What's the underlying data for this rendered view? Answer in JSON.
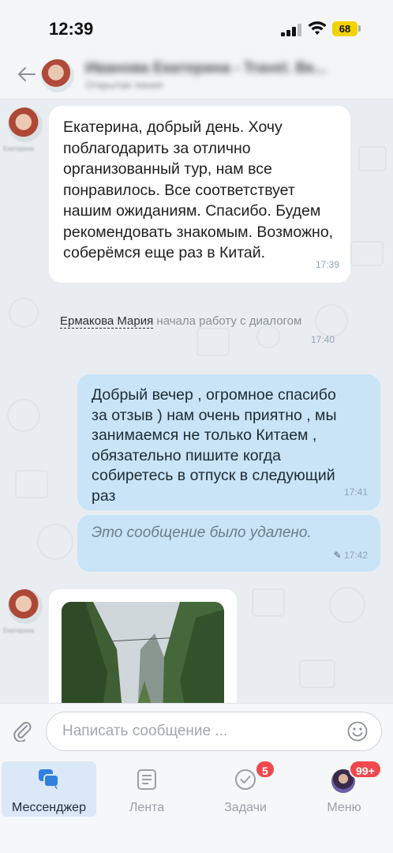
{
  "status_bar": {
    "time": "12:39",
    "battery": "68",
    "battery_color": "#f2d300"
  },
  "header": {
    "title": "Иванова Екатерина - Travel. Вк...",
    "subtitle": "Открытая линия",
    "back_icon": "arrow-left-icon"
  },
  "messages": [
    {
      "type": "incoming",
      "text": "Екатерина, добрый день. Хочу поблагодарить за отлично организованный тур, нам все понравилось. Все соответствует нашим ожиданиям. Спасибо. Будем рекомендовать знакомым. Возможно, соберёмся еще раз в Китай.",
      "time": "17:39",
      "sender_label": "Екатерина"
    },
    {
      "type": "system",
      "name": "Ермакова Мария",
      "text": " начала работу с диалогом",
      "time": "17:40"
    },
    {
      "type": "outgoing",
      "text": "Добрый вечер , огромное спасибо за отзыв ) нам очень приятно , мы занимаемся не только Китаем , обязательно пишите когда собиретесь в отпуск в следующий раз",
      "time": "17:41"
    },
    {
      "type": "outgoing-deleted",
      "text": "Это сообщение было удалено.",
      "time": "17:42",
      "edit_icon": "pencil-icon"
    },
    {
      "type": "incoming-photo",
      "sender_label": "Екатерина",
      "image": "mountain-gorge-photo"
    }
  ],
  "input": {
    "placeholder": "Написать сообщение ...",
    "attach_icon": "paperclip-icon",
    "emoji_icon": "smile-icon"
  },
  "nav": {
    "items": [
      {
        "label": "Мессенджер",
        "icon": "chat-bubbles-icon",
        "active": true
      },
      {
        "label": "Лента",
        "icon": "feed-icon",
        "active": false
      },
      {
        "label": "Задачи",
        "icon": "check-circle-icon",
        "badge": "5",
        "active": false
      },
      {
        "label": "Меню",
        "icon": "user-avatar-icon",
        "badge": "99+",
        "active": false
      }
    ]
  },
  "colors": {
    "chat_bg": "#e9edf1",
    "incoming_bubble": "#ffffff",
    "outgoing_bubble": "#c8e4f6",
    "badge": "#f0484f",
    "active_nav": "#dbe8f7",
    "accent": "#2f80e0"
  }
}
